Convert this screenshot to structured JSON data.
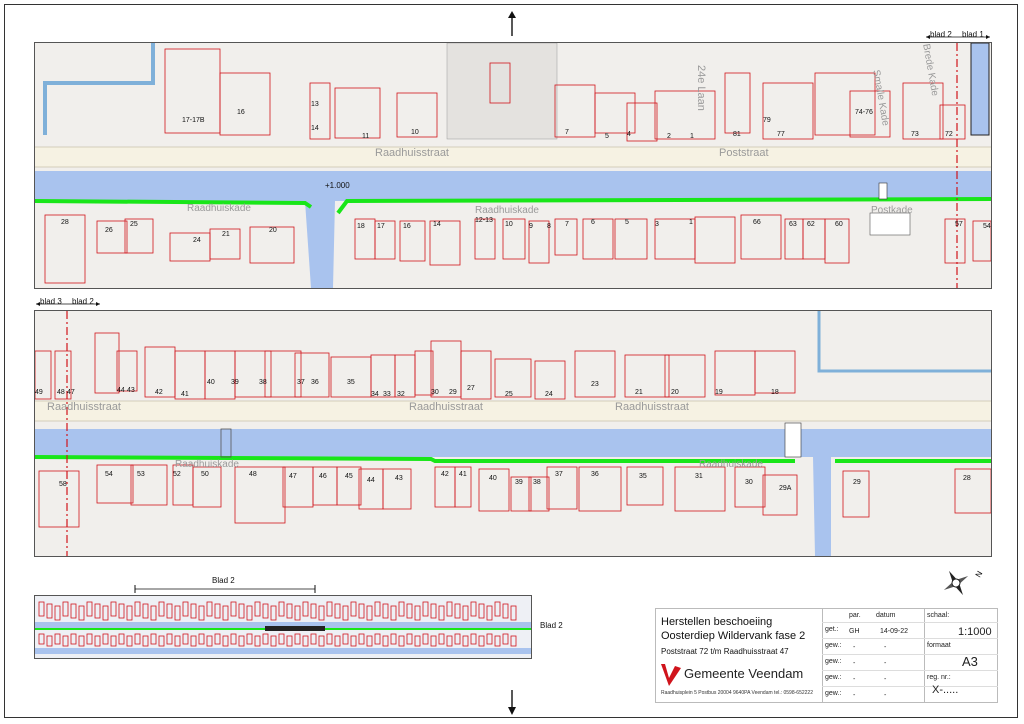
{
  "sheet_markers": {
    "top_right_a": "blad 2",
    "top_right_b": "blad 1",
    "mid_left_a": "blad 3",
    "mid_left_b": "blad 2",
    "overview_title": "Blad 2",
    "overview_side": "Blad 2"
  },
  "top_map": {
    "streets": [
      "Raadhuisstraat",
      "Poststraat",
      "Raadhuiskade",
      "Raadhuiskade",
      "Postkade",
      "24e Laan",
      "Smalle Kade",
      "Brede Kade"
    ],
    "level": "+1.000",
    "north_numbers": [
      "17-17B",
      "16",
      "13",
      "14",
      "11",
      "10",
      "7",
      "5",
      "4",
      "2",
      "1",
      "81",
      "79",
      "77",
      "74-76",
      "73",
      "72"
    ],
    "south_numbers": [
      "28",
      "26",
      "25",
      "24",
      "21",
      "20",
      "18",
      "17",
      "16",
      "14",
      "12-13",
      "10",
      "9",
      "8",
      "7",
      "6",
      "5",
      "3",
      "1",
      "66",
      "63",
      "62",
      "60",
      "57",
      "54"
    ]
  },
  "bottom_map": {
    "streets": [
      "Raadhuisstraat",
      "Raadhuisstraat",
      "Raadhuisstraat",
      "Raadhuiskade",
      "Raadhuiskade"
    ],
    "north_numbers": [
      "49",
      "48",
      "47",
      "44",
      "43",
      "42",
      "41",
      "40",
      "39",
      "38",
      "37",
      "36",
      "35",
      "34",
      "33",
      "32",
      "30",
      "29",
      "27",
      "25",
      "24",
      "23",
      "21",
      "20",
      "19",
      "18"
    ],
    "south_numbers": [
      "58",
      "54",
      "53",
      "52",
      "50",
      "48",
      "47",
      "46",
      "45",
      "44",
      "43",
      "42",
      "41",
      "40",
      "39",
      "38",
      "37",
      "36",
      "35",
      "31",
      "30",
      "29A",
      "29",
      "28"
    ]
  },
  "title_block": {
    "title_line1": "Herstellen beschoeiing",
    "title_line2": "Oosterdiep Wildervank fase 2",
    "subtitle": "Poststraat 72 t/m Raadhuisstraat 47",
    "org": "Gemeente Veendam",
    "address": "Raadhuisplein 5  Postbus 20004  9640PA Veendam tel.: 0598-652222",
    "col_par": "par.",
    "col_datum": "datum",
    "row_get": "get.:",
    "row_gew1": "gew.:",
    "row_gew2": "gew.:",
    "row_gew3": "gew.:",
    "row_gew4": "gew.:",
    "get_par": "GH",
    "get_date": "14-09-22",
    "dash": "-",
    "schaal_label": "schaal:",
    "schaal_value": "1:1000",
    "formaat_label": "formaat",
    "formaat_value": "A3",
    "reg_label": "reg. nr.:",
    "reg_value": "X-....."
  },
  "colors": {
    "water": "#a9c3ee",
    "buildings": "#d0141c",
    "shoreline": "#19e619",
    "road": "#f4f1e6",
    "ground": "#f1efec",
    "cut_line": "#d0141c"
  }
}
